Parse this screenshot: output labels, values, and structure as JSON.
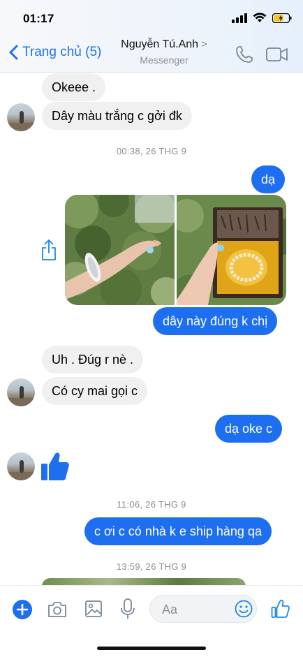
{
  "status_bar": {
    "time": "01:17"
  },
  "header": {
    "back_label": "Trang chủ (5)",
    "contact_name": "Nguyễn Tú.Anh",
    "contact_chevron": ">",
    "subtitle": "Messenger",
    "accent": "#1a73e8"
  },
  "timestamps": [
    "00:38, 26 THG 9",
    "11:06, 26 THG 9",
    "13:59, 26 THG 9"
  ],
  "messages": {
    "m1": "Okeee .",
    "m2": "Dây màu trắng c gởi đk",
    "m3": "dạ",
    "m4": "dây này đúng k chị",
    "m5": "Uh . Đúg r nè .",
    "m6": "Có cy mai gọi c",
    "m7": "dạ oke c",
    "m8": "c ơi c có nhà k e ship hàng qa"
  },
  "composer": {
    "placeholder": "Aa"
  },
  "colors": {
    "outgoing": "#1e6ff0",
    "incoming": "#f0f0f0",
    "accent": "#1a73e8"
  },
  "icons": [
    "signal-icon",
    "wifi-icon",
    "battery-icon",
    "phone-icon",
    "video-call-icon",
    "share-icon",
    "thumbs-up-icon",
    "plus-icon",
    "camera-icon",
    "gallery-icon",
    "microphone-icon",
    "emoji-icon"
  ]
}
